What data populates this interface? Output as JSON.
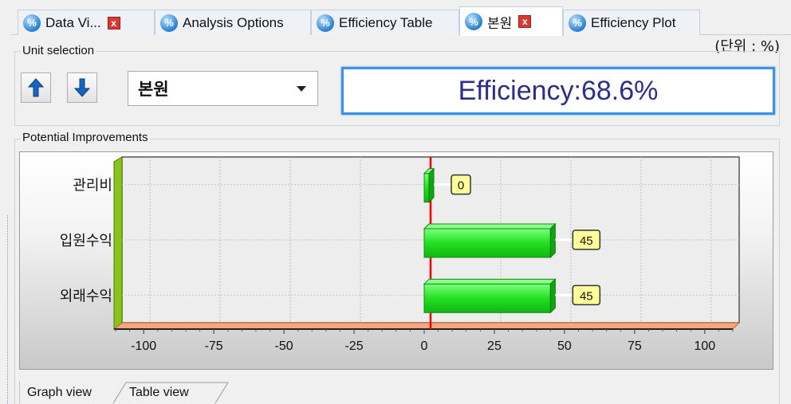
{
  "tabs": [
    {
      "label": "Data Vi...",
      "closable": true,
      "active": false,
      "icon": "percent-icon"
    },
    {
      "label": "Analysis Options",
      "closable": false,
      "active": false,
      "icon": "percent-icon"
    },
    {
      "label": "Efficiency Table",
      "closable": false,
      "active": false,
      "icon": "percent-icon"
    },
    {
      "label": "본원",
      "closable": true,
      "active": true,
      "icon": "percent-icon"
    },
    {
      "label": "Efficiency Plot",
      "closable": false,
      "active": false,
      "icon": "percent-icon"
    }
  ],
  "unit_note": "(단위 : %)",
  "unit_selection": {
    "title": "Unit selection",
    "up_icon": "arrow-up-icon",
    "down_icon": "arrow-down-icon",
    "selected": "본원",
    "efficiency": "Efficiency:68.6%"
  },
  "potential": {
    "title": "Potential Improvements"
  },
  "chart_data": {
    "type": "bar",
    "orientation": "horizontal",
    "categories": [
      "관리비",
      "입원수익",
      "외래수익"
    ],
    "values": [
      0,
      45,
      45
    ],
    "data_labels": [
      "0",
      "45",
      "45"
    ],
    "xlim": [
      -110,
      110
    ],
    "xticks": [
      -100,
      -75,
      -50,
      -25,
      0,
      25,
      50,
      75,
      100
    ],
    "tick_labels": [
      "-100",
      "-75",
      "-50",
      "-25",
      "0",
      "25",
      "50",
      "75",
      "100"
    ],
    "grid": true,
    "bar_color": "#22e022",
    "zero_line_color": "#ff0000"
  },
  "bottom_tabs": [
    {
      "label": "Graph view",
      "active": true
    },
    {
      "label": "Table view",
      "active": false
    }
  ],
  "colors": {
    "accent": "#3a93e6",
    "efficiency_text": "#2b2f88",
    "close_red": "#d53b34",
    "bar_green": "#22e022"
  }
}
